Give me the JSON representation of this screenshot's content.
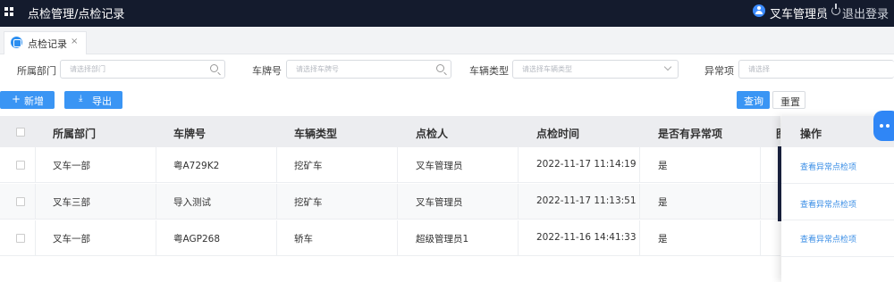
{
  "header": {
    "title": "点检管理/点检记录",
    "username": "叉车管理员",
    "logout": "退出登录"
  },
  "tabs": [
    {
      "label": "点检记录",
      "close": "×"
    }
  ],
  "filters": {
    "dept": {
      "label": "所属部门",
      "placeholder": "请选择部门"
    },
    "plate": {
      "label": "车牌号",
      "placeholder": "请选择车牌号"
    },
    "type": {
      "label": "车辆类型",
      "placeholder": "请选择车辆类型"
    },
    "abnormal": {
      "label": "异常项",
      "placeholder": "请选择"
    }
  },
  "toolbar": {
    "add": "新增",
    "export": "导出",
    "query": "查询",
    "reset": "重置"
  },
  "table": {
    "columns": [
      "所属部门",
      "车牌号",
      "车辆类型",
      "点检人",
      "点检时间",
      "是否有异常项"
    ],
    "action_column": "操作",
    "rows": [
      {
        "dept": "叉车一部",
        "plate": "粤A729K2",
        "type": "挖矿车",
        "inspector": "叉车管理员",
        "time": "2022-11-17 11:14:19",
        "abnormal": "是",
        "action": "查看异常点检项"
      },
      {
        "dept": "叉车三部",
        "plate": "导入测试",
        "type": "挖矿车",
        "inspector": "叉车管理员",
        "time": "2022-11-17 11:13:51",
        "abnormal": "是",
        "action": "查看异常点检项"
      },
      {
        "dept": "叉车一部",
        "plate": "粤AGP268",
        "type": "轿车",
        "inspector": "超级管理员1",
        "time": "2022-11-16 14:41:33",
        "abnormal": "是",
        "action": "查看异常点检项"
      }
    ]
  },
  "colors": {
    "topbar": "#141b2d",
    "primary": "#3a95f4",
    "link": "#3a8ee6"
  }
}
